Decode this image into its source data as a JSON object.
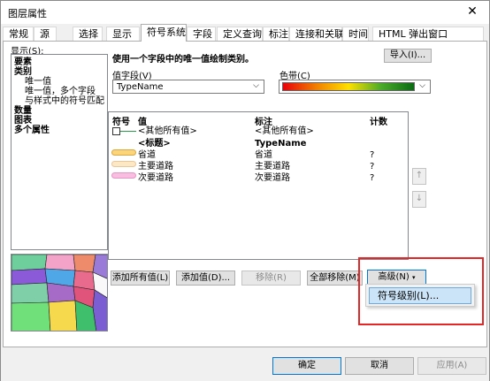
{
  "window": {
    "title": "图层属性",
    "close_glyph": "✕"
  },
  "tabs": [
    "常规",
    "源",
    "选择",
    "显示",
    "符号系统",
    "字段",
    "定义查询",
    "标注",
    "连接和关联",
    "时间",
    "HTML 弹出窗口"
  ],
  "active_tab_index": 4,
  "show_label": "显示(S):",
  "tree": {
    "items": [
      {
        "label": "要素",
        "bold": true
      },
      {
        "label": "类别",
        "bold": true
      },
      {
        "label": "唯一值",
        "bold": false
      },
      {
        "label": "唯一值，多个字段",
        "bold": false
      },
      {
        "label": "与样式中的符号匹配",
        "bold": false
      },
      {
        "label": "数量",
        "bold": true
      },
      {
        "label": "图表",
        "bold": true
      },
      {
        "label": "多个属性",
        "bold": true
      }
    ]
  },
  "description": "使用一个字段中的唯一值绘制类别。",
  "import_button": "导入(I)...",
  "value_field": {
    "label": "值字段(V)",
    "value": "TypeName"
  },
  "color_ramp": {
    "label": "色带(C)",
    "colors": [
      "#e8020a",
      "#f07d00",
      "#ffe000",
      "#4aaa2a",
      "#0a6a12"
    ]
  },
  "grid": {
    "headers": {
      "symbol": "符号",
      "value": "值",
      "label": "标注",
      "count": "计数"
    },
    "rows": [
      {
        "symbol_type": "checkbox-line",
        "value": "<其他所有值>",
        "label": "<其他所有值>",
        "count": "",
        "bold": false
      },
      {
        "symbol_type": "none",
        "value": "<标题>",
        "label": "TypeName",
        "count": "",
        "bold": true
      },
      {
        "symbol_type": "swatch",
        "color": "#fcd479",
        "value": "省道",
        "label": "省道",
        "count": "?",
        "bold": false
      },
      {
        "symbol_type": "swatch",
        "color": "#fde8c6",
        "value": "主要道路",
        "label": "主要道路",
        "count": "?",
        "bold": false
      },
      {
        "symbol_type": "swatch",
        "color": "#f8bde0",
        "value": "次要道路",
        "label": "次要道路",
        "count": "?",
        "bold": false
      }
    ]
  },
  "move_up_icon": "arrow-up-icon",
  "move_down_icon": "arrow-down-icon",
  "buttons": {
    "add_all": "添加所有值(L)",
    "add_values": "添加值(D)...",
    "remove": "移除(R)",
    "remove_all": "全部移除(M)",
    "advanced": "高级(N)"
  },
  "advanced_menu": {
    "items": [
      "符号级别(L)..."
    ]
  },
  "dialog_buttons": {
    "ok": "确定",
    "cancel": "取消",
    "apply": "应用(A)"
  }
}
